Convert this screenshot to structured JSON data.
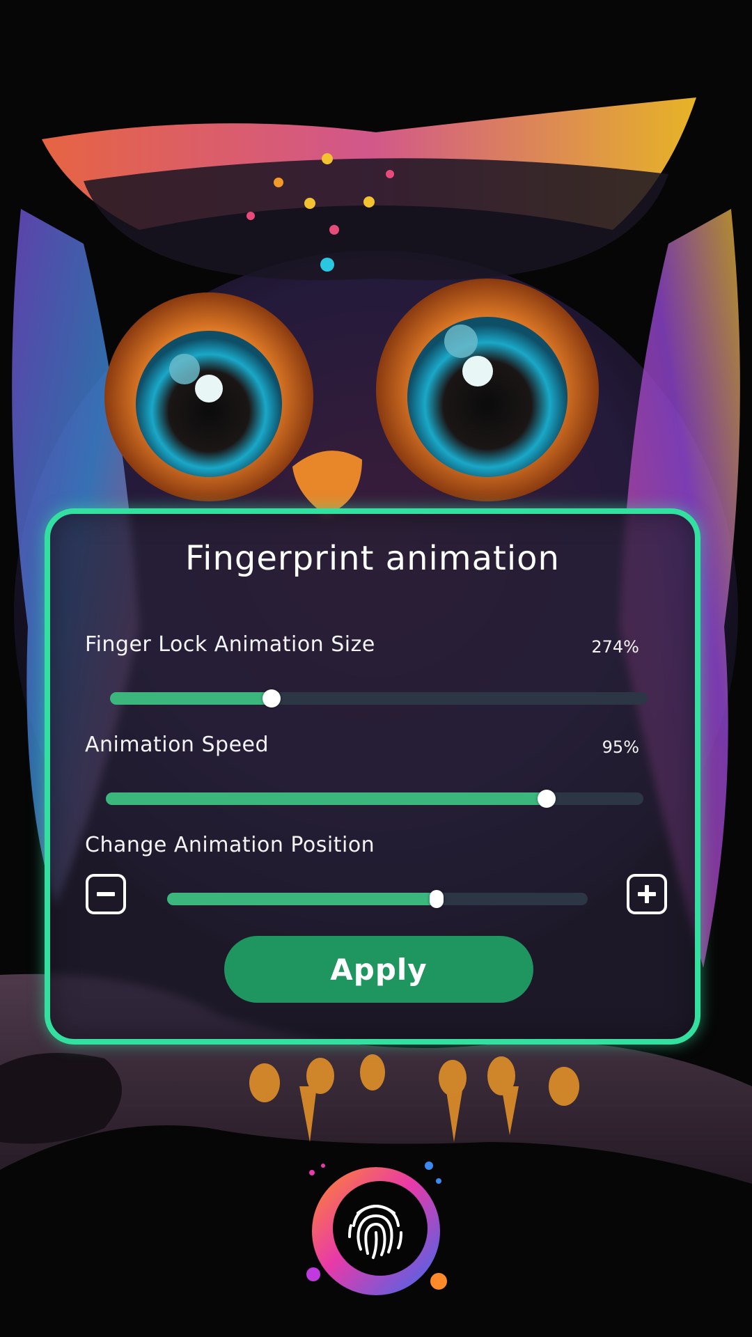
{
  "panel": {
    "title": "Fingerprint animation",
    "size_setting": {
      "label": "Finger Lock Animation Size",
      "value_text": "274%",
      "slider_fraction": 0.3
    },
    "speed_setting": {
      "label": "Animation Speed",
      "value_text": "95%",
      "slider_fraction": 0.82
    },
    "position_setting": {
      "label": "Change Animation Position",
      "slider_fraction": 0.64
    },
    "apply_label": "Apply"
  },
  "colors": {
    "accent_border": "#33e0a0",
    "slider_fill": "#3bb67c",
    "slider_track": "#2d3644",
    "apply_button": "#1f9660"
  },
  "icons": {
    "minus": "minus-icon",
    "plus": "plus-icon",
    "fingerprint": "fingerprint-icon"
  }
}
